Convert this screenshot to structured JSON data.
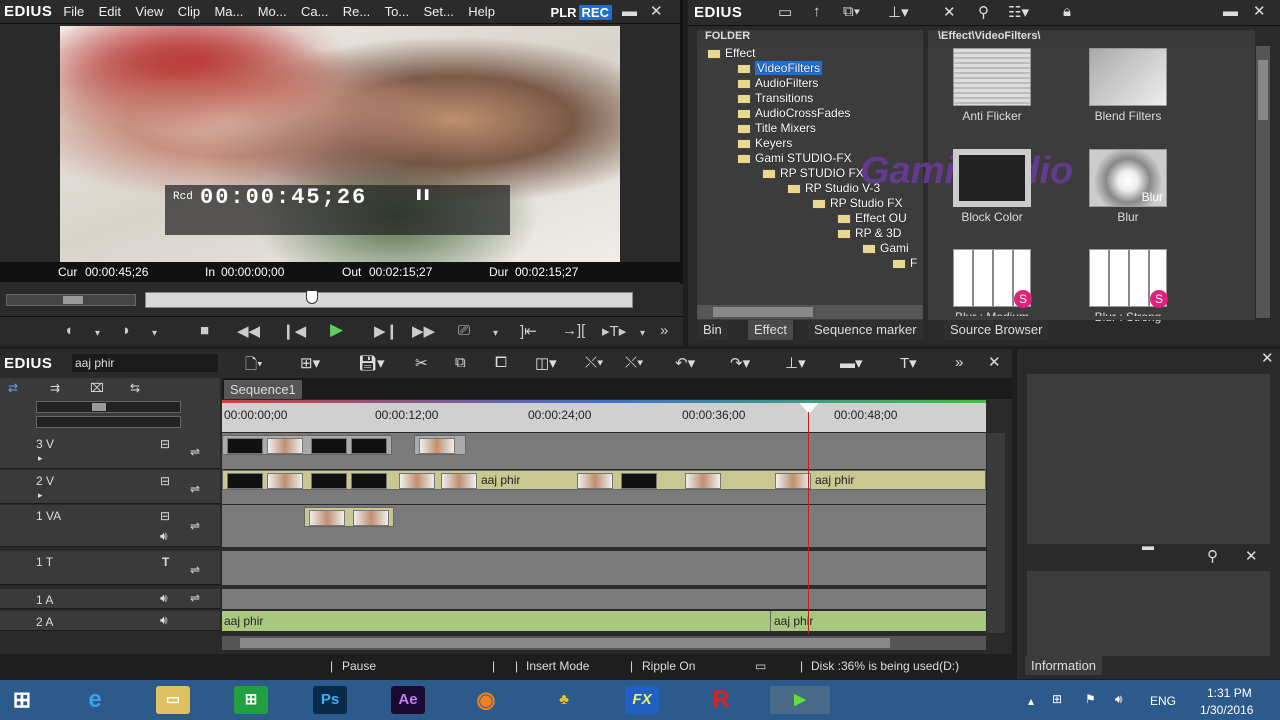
{
  "player": {
    "logo": "EDIUS",
    "menu": [
      "File",
      "Edit",
      "View",
      "Clip",
      "Ma...",
      "Mo...",
      "Ca...",
      "Re...",
      "To...",
      "Set...",
      "Help"
    ],
    "plr": "PLR",
    "rec": "REC",
    "timecode_label": "Rcd",
    "timecode": "00:00:45;26",
    "cur_label": "Cur",
    "cur": "00:00:45;26",
    "in_label": "In",
    "in": "00:00:00;00",
    "out_label": "Out",
    "out": "00:02:15;27",
    "dur_label": "Dur",
    "dur": "00:02:15;27"
  },
  "bin": {
    "logo": "EDIUS",
    "folder_header": "FOLDER",
    "path": "\\Effect\\VideoFilters\\",
    "tree": {
      "root": "Effect",
      "items": [
        "VideoFilters",
        "AudioFilters",
        "Transitions",
        "AudioCrossFades",
        "Title Mixers",
        "Keyers",
        "Gami STUDIO-FX"
      ],
      "sub": [
        "RP STUDIO FX",
        "RP Studio V-3",
        "RP Studio FX",
        "Effect OU",
        "RP & 3D",
        "Gami",
        "F"
      ]
    },
    "watermark": "GamiStudio",
    "effects": [
      {
        "label": "Anti Flicker"
      },
      {
        "label": "Blend Filters"
      },
      {
        "label": "Block Color"
      },
      {
        "label": "Blur",
        "overlay": "Blur"
      },
      {
        "label": "Blur : Medium"
      },
      {
        "label": "Blur : Strong"
      }
    ],
    "tabs": [
      "Bin",
      "Effect",
      "Sequence marker",
      "Source Browser"
    ]
  },
  "timeline": {
    "logo": "EDIUS",
    "project": "aaj phir",
    "sequence_tab": "Sequence1",
    "ruler": [
      "00:00:00;00",
      "00:00:12;00",
      "00:00:24;00",
      "00:00:36;00",
      "00:00:48;00"
    ],
    "tracks": [
      {
        "name": "3 V"
      },
      {
        "name": "2 V"
      },
      {
        "name": "1 VA"
      },
      {
        "name": "1 T"
      },
      {
        "name": "1 A"
      },
      {
        "name": "2 A"
      }
    ],
    "clip_label": "aaj phir"
  },
  "status": {
    "pause": "Pause",
    "mode": "Insert Mode",
    "ripple": "Ripple On",
    "disk": "Disk :36% is being used(D:)"
  },
  "info": {
    "tab": "Information"
  },
  "taskbar": {
    "lang": "ENG",
    "time": "1:31 PM",
    "date": "1/30/2016",
    "apps": [
      "Ps",
      "Ae",
      "FX",
      "R"
    ]
  }
}
